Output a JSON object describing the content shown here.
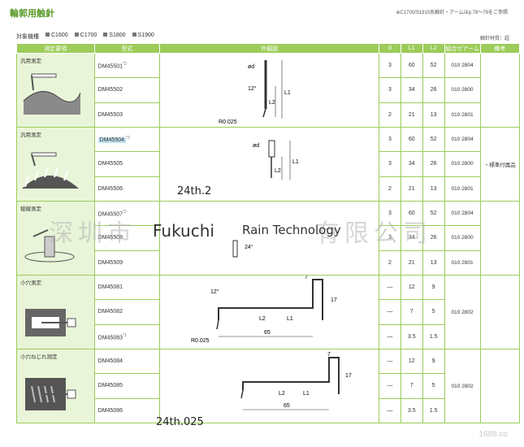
{
  "header": {
    "title": "輪郭用触針",
    "note": "※C1700/S1910系触針・アームはp.78〜79をご参照",
    "machines_label": "対象機種",
    "machines": [
      "C1600",
      "C1700",
      "S1800",
      "S1900"
    ],
    "unit_note": "触針材質：超"
  },
  "columns": [
    "測定要領",
    "型式",
    "外観図",
    "d",
    "L1",
    "L2",
    "組合せアーム",
    "備考"
  ],
  "groups": [
    {
      "category": "汎用測定",
      "combo": "",
      "remark": "",
      "rows": [
        {
          "model": "DM45501",
          "mark": "*2",
          "d": "3",
          "L1": "60",
          "L2": "52",
          "combo": "010 2804"
        },
        {
          "model": "DM45502",
          "mark": "",
          "d": "3",
          "L1": "34",
          "L2": "26",
          "combo": "010 2800"
        },
        {
          "model": "DM45503",
          "mark": "",
          "d": "2",
          "L1": "21",
          "L2": "13",
          "combo": "010 2801"
        }
      ],
      "fig": {
        "d": "ød",
        "angle": "12°",
        "l2": "L2",
        "l1": "L1",
        "radius": "R0.025"
      }
    },
    {
      "category": "汎用測定",
      "combo": "",
      "remark": "・標準付属品",
      "rows": [
        {
          "model": "DM45504",
          "mark": "*2",
          "d": "3",
          "L1": "60",
          "L2": "52",
          "combo": "010 2804"
        },
        {
          "model": "DM45505",
          "mark": "",
          "d": "3",
          "L1": "34",
          "L2": "26",
          "combo": "010 2800"
        },
        {
          "model": "DM45506",
          "mark": "",
          "d": "2",
          "L1": "21",
          "L2": "13",
          "combo": "010 2801"
        }
      ],
      "fig": {
        "d": "ød",
        "l2": "L2",
        "l1": "L1"
      }
    },
    {
      "category": "稜線測定",
      "combo": "",
      "remark": "",
      "rows": [
        {
          "model": "DM45507",
          "mark": "*2",
          "d": "3",
          "L1": "60",
          "L2": "52",
          "combo": "010 2804"
        },
        {
          "model": "DM45508",
          "mark": "",
          "d": "3",
          "L1": "34",
          "L2": "26",
          "combo": "010 2800"
        },
        {
          "model": "DM45509",
          "mark": "",
          "d": "2",
          "L1": "21",
          "L2": "13",
          "combo": "010 2801"
        }
      ],
      "fig": {
        "angle": "24°"
      }
    },
    {
      "category": "小穴測定",
      "combo": "010 2802",
      "remark": "",
      "rows": [
        {
          "model": "DM45081",
          "mark": "",
          "d": "—",
          "L1": "12",
          "L2": "9",
          "combo": ""
        },
        {
          "model": "DM45082",
          "mark": "",
          "d": "—",
          "L1": "7",
          "L2": "5",
          "combo": ""
        },
        {
          "model": "DM45083",
          "mark": "*1",
          "d": "—",
          "L1": "3.5",
          "L2": "1.5",
          "combo": ""
        }
      ],
      "fig": {
        "angle": "12°",
        "top": "7",
        "height": "17",
        "l2": "L2",
        "l1": "L1",
        "length": "65",
        "radius": "R0.025"
      }
    },
    {
      "category": "小穴ねじれ測定",
      "combo": "010 2802",
      "remark": "",
      "rows": [
        {
          "model": "DM45084",
          "mark": "",
          "d": "—",
          "L1": "12",
          "L2": "9",
          "combo": ""
        },
        {
          "model": "DM45085",
          "mark": "",
          "d": "—",
          "L1": "7",
          "L2": "5",
          "combo": ""
        },
        {
          "model": "DM45086",
          "mark": "",
          "d": "—",
          "L1": "3.5",
          "L2": "1.5",
          "combo": ""
        }
      ],
      "fig": {
        "top": "7",
        "height": "17",
        "l2": "L2",
        "l1": "L1",
        "length": "65"
      }
    }
  ],
  "watermarks": {
    "chinese": "深圳市",
    "chinese2": "有限公司",
    "fukuchi": "Fukuchi",
    "rain": "Rain Technology",
    "overlay1": "24th.2",
    "overlay2": "24th.025",
    "url": "1688.co"
  }
}
